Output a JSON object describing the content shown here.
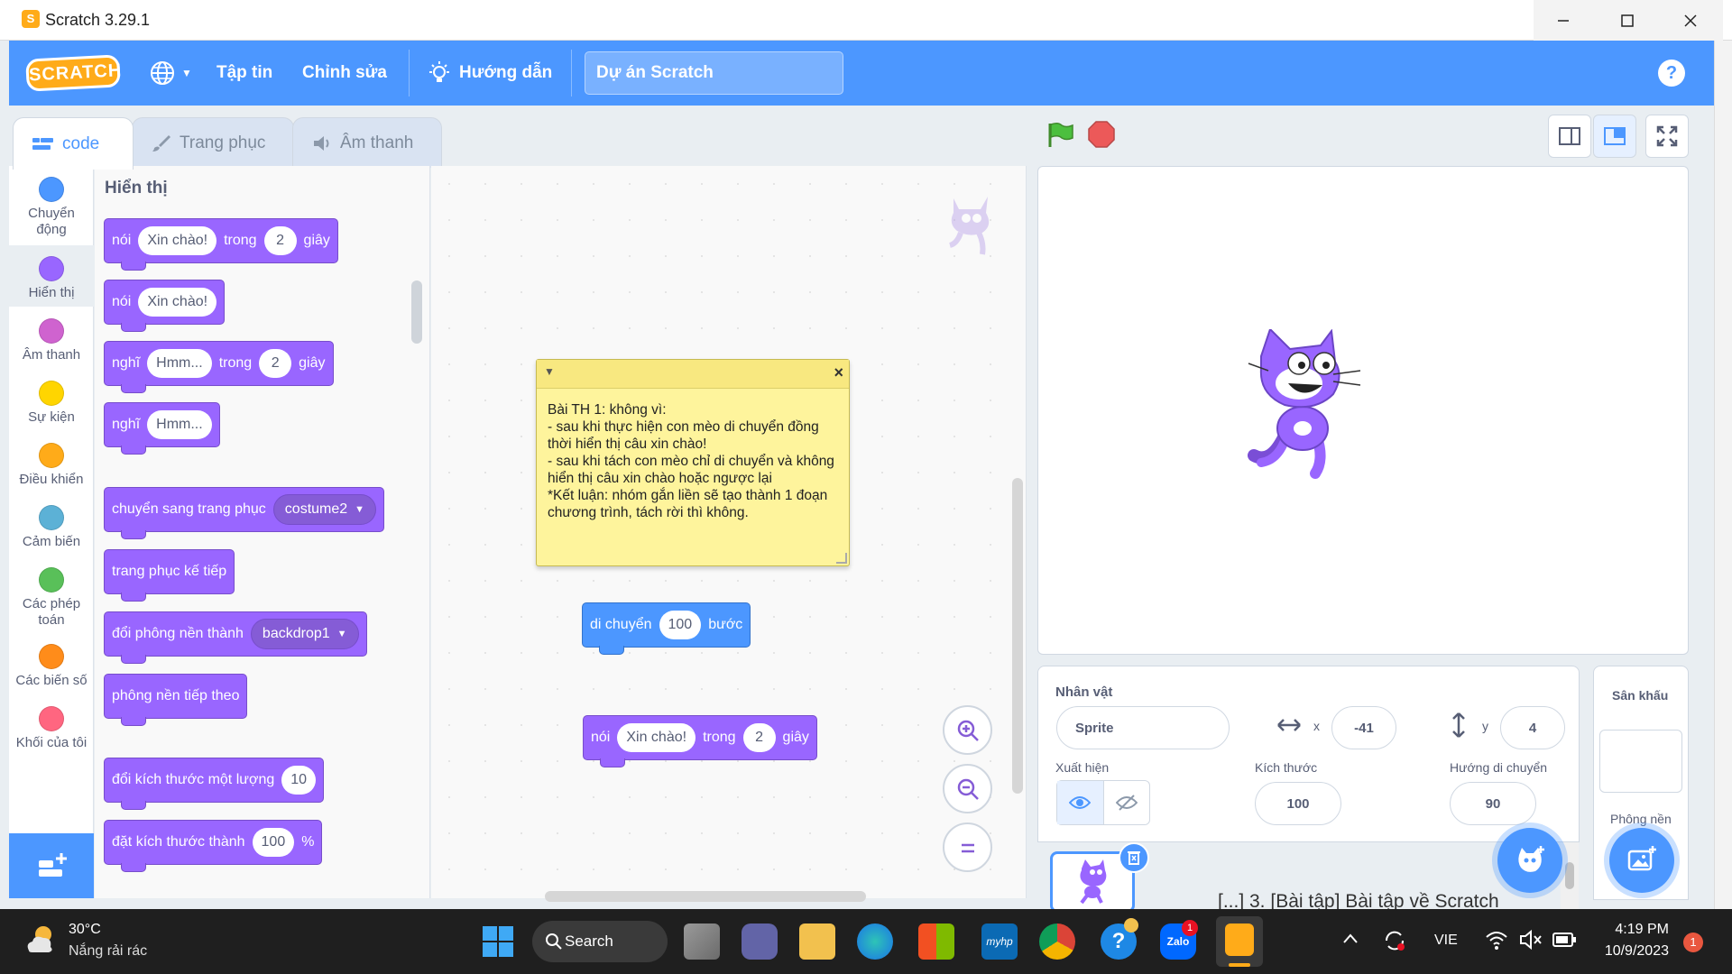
{
  "window": {
    "title": "Scratch 3.29.1",
    "app_icon": "scratch-cat-icon"
  },
  "menubar": {
    "logo_text": "SCRATCH",
    "file": "Tập tin",
    "edit": "Chỉnh sửa",
    "tutorials": "Hướng dẫn",
    "project_title": "Dự án Scratch",
    "help": "?"
  },
  "tabs": {
    "code": "code",
    "costumes": "Trang phục",
    "sounds": "Âm thanh"
  },
  "categories": [
    {
      "l1": "Chuyển",
      "l2": "động",
      "color": "#4c97ff"
    },
    {
      "l1": "Hiển thị",
      "l2": "",
      "color": "#9966ff"
    },
    {
      "l1": "Âm thanh",
      "l2": "",
      "color": "#cf63cf"
    },
    {
      "l1": "Sự kiện",
      "l2": "",
      "color": "#ffd500"
    },
    {
      "l1": "Điều khiển",
      "l2": "",
      "color": "#ffab19"
    },
    {
      "l1": "Cảm biến",
      "l2": "",
      "color": "#5cb1d6"
    },
    {
      "l1": "Các phép",
      "l2": "toán",
      "color": "#59c059"
    },
    {
      "l1": "Các biến số",
      "l2": "",
      "color": "#ff8c1a"
    },
    {
      "l1": "Khối của tôi",
      "l2": "",
      "color": "#ff6680"
    }
  ],
  "palette": {
    "heading": "Hiển thị",
    "say_for": {
      "say": "nói",
      "msg": "Xin chào!",
      "for": "trong",
      "secs": "2",
      "unit": "giây"
    },
    "say": {
      "say": "nói",
      "msg": "Xin chào!"
    },
    "think_for": {
      "think": "nghĩ",
      "msg": "Hmm...",
      "for": "trong",
      "secs": "2",
      "unit": "giây"
    },
    "think": {
      "think": "nghĩ",
      "msg": "Hmm..."
    },
    "switch_costume": {
      "text": "chuyển sang trang phục",
      "value": "costume2"
    },
    "next_costume": "trang phục kế tiếp",
    "switch_backdrop": {
      "text": "đổi phông nền thành",
      "value": "backdrop1"
    },
    "next_backdrop": "phông nền tiếp theo",
    "change_size": {
      "text": "đổi kích thước một lượng",
      "value": "10"
    },
    "set_size": {
      "text": "đặt kích thước thành",
      "value": "100",
      "unit": "%"
    }
  },
  "workspace": {
    "comment": "Bài TH 1: không vì:\n- sau khi thực hiện con mèo di chuyển đồng thời hiển thị câu xin chào!\n- sau khi tách con mèo chỉ di chuyển và không hiển thị câu xin chào hoặc ngược lại\n*Kết luận: nhóm gắn liền sẽ tạo thành 1 đoạn chương trình, tách rời thì không.",
    "move_block": {
      "text": "di chuyển",
      "value": "100",
      "unit": "bước"
    },
    "say_block": {
      "say": "nói",
      "msg": "Xin chào!",
      "for": "trong",
      "secs": "2",
      "unit": "giây"
    }
  },
  "sprite_info": {
    "sprite_label": "Nhân vật",
    "sprite_name": "Sprite",
    "x_label": "x",
    "x": "-41",
    "y_label": "y",
    "y": "4",
    "show_label": "Xuất hiện",
    "size_label": "Kích thước",
    "size": "100",
    "direction_label": "Hướng di chuyển",
    "direction": "90"
  },
  "stage_pane": {
    "label": "Sân khấu",
    "backdrops": "Phông nền"
  },
  "taskbar": {
    "temp": "30°C",
    "weather": "Nắng rải rác",
    "search": "Search",
    "lang": "VIE",
    "time": "4:19 PM",
    "date": "10/9/2023",
    "behind_text": "[...] 3. [Bài tập] Bài tập về Scratch",
    "notif": "1",
    "zalo_badge": "1",
    "zalo": "Zalo",
    "hp": "myhp"
  }
}
